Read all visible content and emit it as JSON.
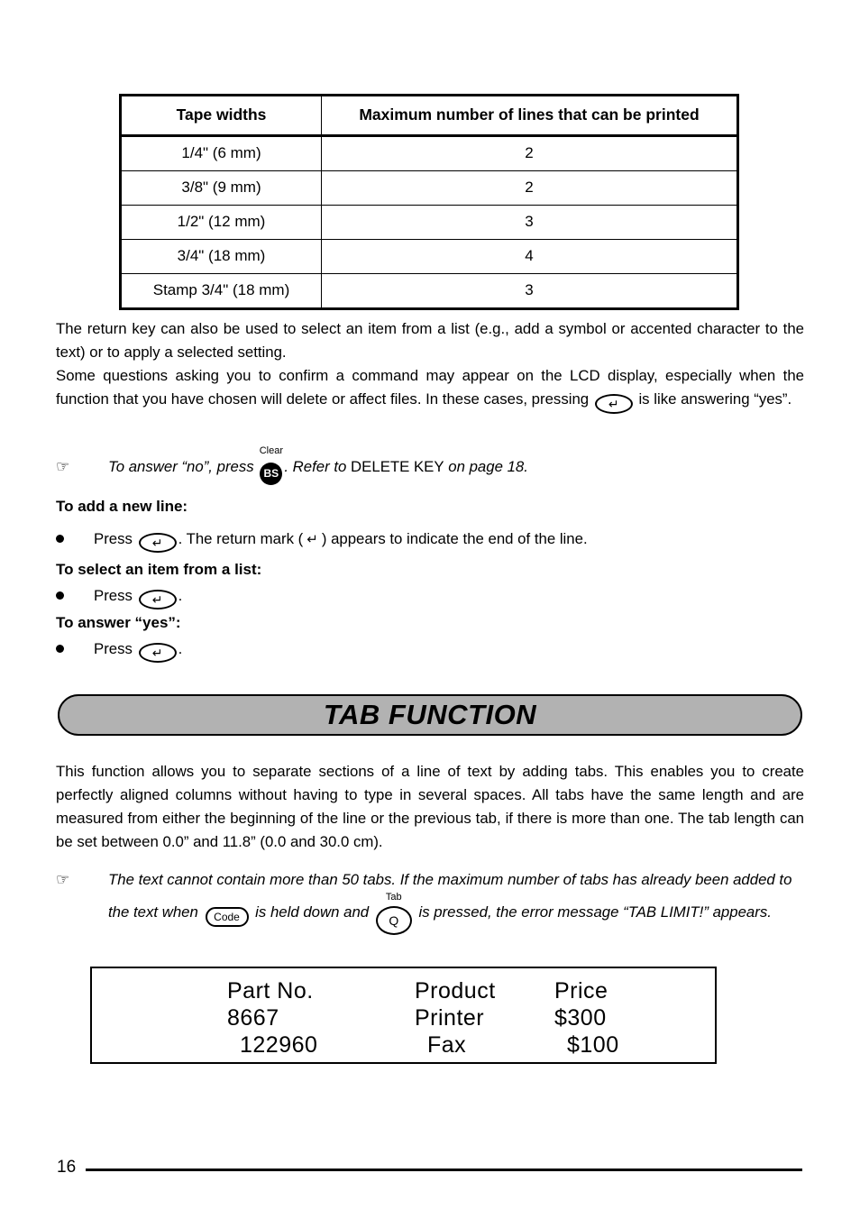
{
  "table": {
    "headers": [
      "Tape widths",
      "Maximum number of lines that can be printed"
    ],
    "rows": [
      [
        "1/4\" (6 mm)",
        "2"
      ],
      [
        "3/8\" (9 mm)",
        "2"
      ],
      [
        "1/2\" (12 mm)",
        "3"
      ],
      [
        "3/4\" (18 mm)",
        "4"
      ],
      [
        "Stamp 3/4\" (18 mm)",
        "3"
      ]
    ]
  },
  "paragraphs": {
    "p1": "The return key can also be used to select an item from a list (e.g., add a symbol or accented character to the text) or to apply a selected setting.",
    "p2_a": "Some questions asking you to confirm a command may appear on the LCD display, especially when the function that you have chosen will delete or affect files. In these cases, pressing",
    "p2_b": "is like answering “yes”.",
    "p3": "This function allows you to separate sections of a line of text by adding tabs. This enables you to create perfectly aligned columns without having to type in several spaces. All tabs have the same length and are measured from either the beginning of the line or the previous tab, if there is more than one. The tab length can be set between 0.0” and 11.8” (0.0 and 30.0 cm)."
  },
  "notes": {
    "hand_glyph": "☞",
    "note1_a": "To answer “no”, press",
    "note1_b": ". Refer to",
    "note1_c": "DELETE KEY",
    "note1_d": "on page 18.",
    "note2_a": "The text cannot contain more than 50 tabs. If the maximum number of tabs has already been added to the text when",
    "note2_b": "is held down and",
    "note2_c": "is pressed, the error message",
    "note2_d": "“TAB LIMIT!” appears."
  },
  "sections": {
    "add_line_heading": "To add a new line:",
    "add_line_press": "Press",
    "add_line_rest_a": ". The return mark (",
    "add_line_rest_b": ") appears to indicate the end of the line.",
    "select_heading": "To select an item from a list:",
    "select_press": "Press",
    "yes_heading": "To answer “yes”:",
    "yes_press": "Press",
    "period": "."
  },
  "keys": {
    "return_glyph": "↵",
    "return_mark_glyph": "↵",
    "bs_label": "BS",
    "bs_cap": "Clear",
    "code_label": "Code",
    "q_label": "Q",
    "q_cap": "Tab"
  },
  "banner": {
    "title": "TAB FUNCTION",
    "fill_color": "#b2b2b2"
  },
  "example": {
    "rows": [
      {
        "c1": "Part No.",
        "c2": "Product",
        "c3": "Price",
        "indent": false
      },
      {
        "c1": "8667",
        "c2": "Printer",
        "c3": "$300",
        "indent": false
      },
      {
        "c1": "122960",
        "c2": "Fax",
        "c3": "$100",
        "indent": true
      }
    ]
  },
  "footer": {
    "page_number": "16"
  }
}
